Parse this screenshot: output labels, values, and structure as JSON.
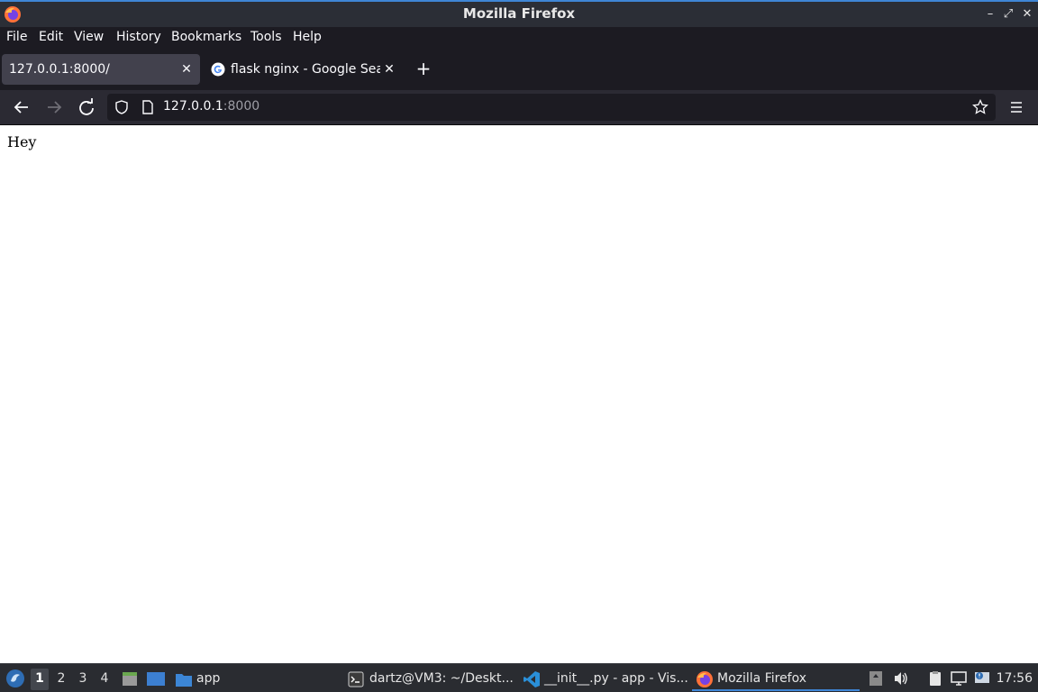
{
  "window": {
    "title": "Mozilla Firefox"
  },
  "menubar": {
    "items": [
      {
        "label": "File"
      },
      {
        "label": "Edit"
      },
      {
        "label": "View"
      },
      {
        "label": "History"
      },
      {
        "label": "Bookmarks"
      },
      {
        "label": "Tools"
      },
      {
        "label": "Help"
      }
    ]
  },
  "tabs": [
    {
      "title": "127.0.0.1:8000/",
      "active": true
    },
    {
      "title": "flask nginx - Google Sear",
      "active": false,
      "icon": "google-icon"
    }
  ],
  "newtab_label": "+",
  "urlbar": {
    "host": "127.0.0.1",
    "port": ":8000"
  },
  "page": {
    "text": "Hey"
  },
  "taskbar": {
    "workspaces": [
      {
        "label": "1",
        "active": true
      },
      {
        "label": "2",
        "active": false
      },
      {
        "label": "3",
        "active": false
      },
      {
        "label": "4",
        "active": false
      }
    ],
    "launchers": [
      {
        "label": "app",
        "icon": "folder-icon"
      }
    ],
    "tasks": [
      {
        "label": "dartz@VM3: ~/Deskt...",
        "icon": "terminal-icon",
        "active": false
      },
      {
        "label": "__init__.py - app - Vis...",
        "icon": "vscode-icon",
        "active": false
      },
      {
        "label": "Mozilla Firefox",
        "icon": "firefox-icon",
        "active": true
      }
    ],
    "clock": "17:56"
  },
  "colors": {
    "accent": "#3f86d6",
    "chrome_dark": "#1c1b22",
    "toolbar": "#2b2a33"
  }
}
